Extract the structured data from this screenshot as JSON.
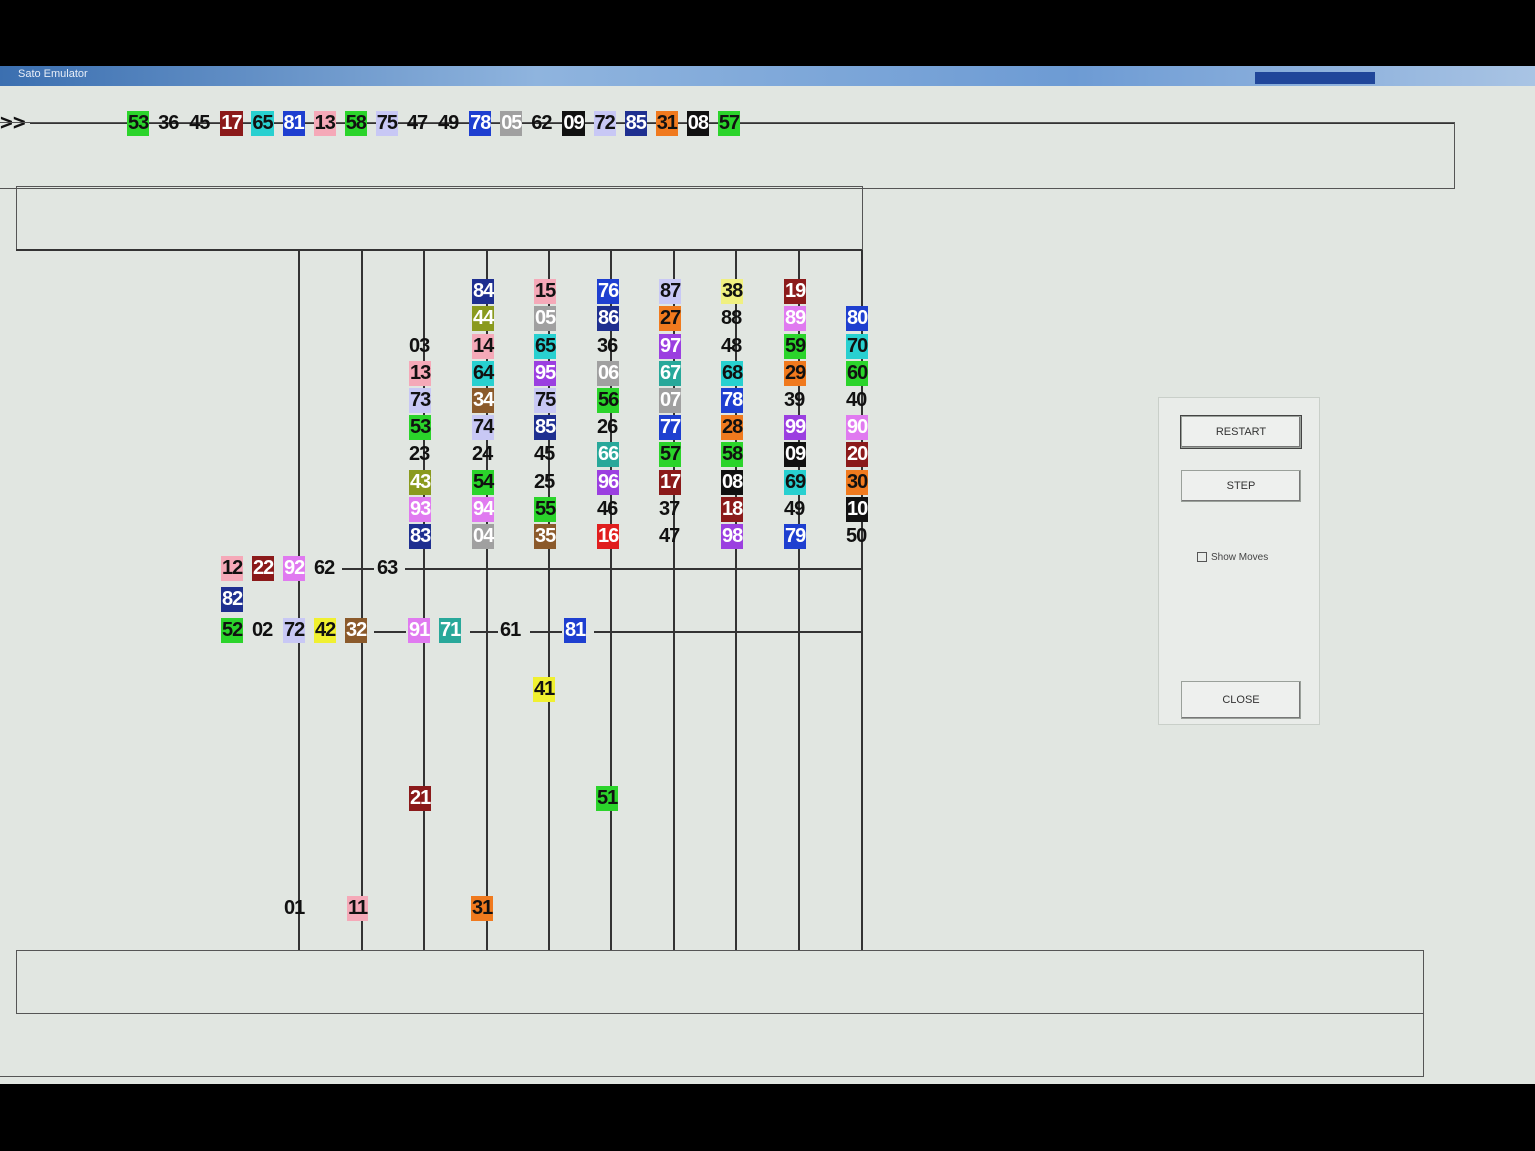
{
  "window": {
    "title": "Sato Emulator"
  },
  "prompt": ">>",
  "sequence": [
    {
      "n": "53",
      "c": "#2bd42b"
    },
    {
      "n": "36",
      "c": ""
    },
    {
      "n": "45",
      "c": ""
    },
    {
      "n": "17",
      "c": "#8b1a1a"
    },
    {
      "n": "65",
      "c": "#28d0d0"
    },
    {
      "n": "81",
      "c": "#1e3fd0"
    },
    {
      "n": "13",
      "c": "#f5a9b8"
    },
    {
      "n": "58",
      "c": "#2bd42b"
    },
    {
      "n": "75",
      "c": "#c8c8f5"
    },
    {
      "n": "47",
      "c": ""
    },
    {
      "n": "49",
      "c": ""
    },
    {
      "n": "78",
      "c": "#1e3fd0"
    },
    {
      "n": "05",
      "c": "#a0a0a0"
    },
    {
      "n": "62",
      "c": ""
    },
    {
      "n": "09",
      "c": "#111111"
    },
    {
      "n": "72",
      "c": "#c8c8f5"
    },
    {
      "n": "85",
      "c": "#1e2f90"
    },
    {
      "n": "31",
      "c": "#f07a1e"
    },
    {
      "n": "08",
      "c": "#111111"
    },
    {
      "n": "57",
      "c": "#2bd42b"
    }
  ],
  "columns": [
    [
      {
        "n": "03",
        "c": ""
      },
      {
        "n": "13",
        "c": "#f5a9b8"
      },
      {
        "n": "73",
        "c": "#c8c8f5"
      },
      {
        "n": "53",
        "c": "#2bd42b"
      },
      {
        "n": "23",
        "c": ""
      },
      {
        "n": "43",
        "c": "#8a9a1e"
      },
      {
        "n": "93",
        "c": "#e07af0"
      },
      {
        "n": "83",
        "c": "#1e2f90"
      }
    ],
    [
      {
        "n": "84",
        "c": "#1e2f90"
      },
      {
        "n": "44",
        "c": "#8a9a1e"
      },
      {
        "n": "14",
        "c": "#f5a9b8"
      },
      {
        "n": "64",
        "c": "#28d0d0"
      },
      {
        "n": "34",
        "c": "#8b5a2b"
      },
      {
        "n": "74",
        "c": "#c8c8f5"
      },
      {
        "n": "24",
        "c": ""
      },
      {
        "n": "54",
        "c": "#2bd42b"
      },
      {
        "n": "94",
        "c": "#e07af0"
      },
      {
        "n": "04",
        "c": "#a0a0a0"
      }
    ],
    [
      {
        "n": "15",
        "c": "#f5a9b8"
      },
      {
        "n": "05",
        "c": "#a0a0a0"
      },
      {
        "n": "65",
        "c": "#28d0d0"
      },
      {
        "n": "95",
        "c": "#9b3fe0"
      },
      {
        "n": "75",
        "c": "#c8c8f5"
      },
      {
        "n": "85",
        "c": "#1e2f90"
      },
      {
        "n": "45",
        "c": ""
      },
      {
        "n": "25",
        "c": ""
      },
      {
        "n": "55",
        "c": "#2bd42b"
      },
      {
        "n": "35",
        "c": "#8b5a2b"
      }
    ],
    [
      {
        "n": "76",
        "c": "#1e3fd0"
      },
      {
        "n": "86",
        "c": "#1e2f90"
      },
      {
        "n": "36",
        "c": ""
      },
      {
        "n": "06",
        "c": "#a0a0a0"
      },
      {
        "n": "56",
        "c": "#2bd42b"
      },
      {
        "n": "26",
        "c": ""
      },
      {
        "n": "66",
        "c": "#28a89a"
      },
      {
        "n": "96",
        "c": "#9b3fe0"
      },
      {
        "n": "46",
        "c": ""
      },
      {
        "n": "16",
        "c": "#e01e1e"
      }
    ],
    [
      {
        "n": "87",
        "c": "#c8c8f5"
      },
      {
        "n": "27",
        "c": "#f07a1e"
      },
      {
        "n": "97",
        "c": "#9b3fe0"
      },
      {
        "n": "67",
        "c": "#28a89a"
      },
      {
        "n": "07",
        "c": "#a0a0a0"
      },
      {
        "n": "77",
        "c": "#1e3fd0"
      },
      {
        "n": "57",
        "c": "#2bd42b"
      },
      {
        "n": "17",
        "c": "#8b1a1a"
      },
      {
        "n": "37",
        "c": ""
      },
      {
        "n": "47",
        "c": ""
      }
    ],
    [
      {
        "n": "38",
        "c": "#f0f080"
      },
      {
        "n": "88",
        "c": ""
      },
      {
        "n": "48",
        "c": ""
      },
      {
        "n": "68",
        "c": "#28d0d0"
      },
      {
        "n": "78",
        "c": "#1e3fd0"
      },
      {
        "n": "28",
        "c": "#f07a1e"
      },
      {
        "n": "58",
        "c": "#2bd42b"
      },
      {
        "n": "08",
        "c": "#111111"
      },
      {
        "n": "18",
        "c": "#8b1a1a"
      },
      {
        "n": "98",
        "c": "#9b3fe0"
      }
    ],
    [
      {
        "n": "19",
        "c": "#8b1a1a"
      },
      {
        "n": "89",
        "c": "#e07af0"
      },
      {
        "n": "59",
        "c": "#2bd42b"
      },
      {
        "n": "29",
        "c": "#f07a1e"
      },
      {
        "n": "39",
        "c": ""
      },
      {
        "n": "99",
        "c": "#9b3fe0"
      },
      {
        "n": "09",
        "c": "#111111"
      },
      {
        "n": "69",
        "c": "#28d0d0"
      },
      {
        "n": "49",
        "c": ""
      },
      {
        "n": "79",
        "c": "#1e3fd0"
      }
    ],
    [
      {
        "n": "80",
        "c": "#1e3fd0"
      },
      {
        "n": "70",
        "c": "#28d0d0"
      },
      {
        "n": "60",
        "c": "#2bd42b"
      },
      {
        "n": "40",
        "c": ""
      },
      {
        "n": "90",
        "c": "#e07af0"
      },
      {
        "n": "20",
        "c": "#8b1a1a"
      },
      {
        "n": "30",
        "c": "#f07a1e"
      },
      {
        "n": "10",
        "c": "#111111"
      },
      {
        "n": "50",
        "c": ""
      }
    ]
  ],
  "upper_chain": [
    {
      "n": "12",
      "c": "#f5a9b8"
    },
    {
      "n": "22",
      "c": "#8b1a1a"
    },
    {
      "n": "92",
      "c": "#e07af0"
    },
    {
      "n": "62",
      "c": ""
    },
    {
      "n": "63",
      "c": ""
    }
  ],
  "link_chip": {
    "n": "82",
    "c": "#1e2f90"
  },
  "lower_chain": [
    {
      "n": "52",
      "c": "#2bd42b"
    },
    {
      "n": "02",
      "c": ""
    },
    {
      "n": "72",
      "c": "#c8c8f5"
    },
    {
      "n": "42",
      "c": "#f0f030"
    },
    {
      "n": "32",
      "c": "#8b5a2b"
    },
    {
      "n": "91",
      "c": "#e07af0"
    },
    {
      "n": "71",
      "c": "#28a89a"
    },
    {
      "n": "61",
      "c": ""
    },
    {
      "n": "81",
      "c": "#1e3fd0"
    }
  ],
  "floating": [
    {
      "n": "41",
      "c": "#f0f030"
    },
    {
      "n": "21",
      "c": "#8b1a1a"
    },
    {
      "n": "51",
      "c": "#2bd42b"
    },
    {
      "n": "01",
      "c": ""
    },
    {
      "n": "11",
      "c": "#f5a9b8"
    },
    {
      "n": "31",
      "c": "#f07a1e"
    }
  ],
  "panel": {
    "restart_label": "RESTART",
    "step_label": "STEP",
    "checkbox_label": "Show Moves",
    "close_label": "CLOSE"
  }
}
